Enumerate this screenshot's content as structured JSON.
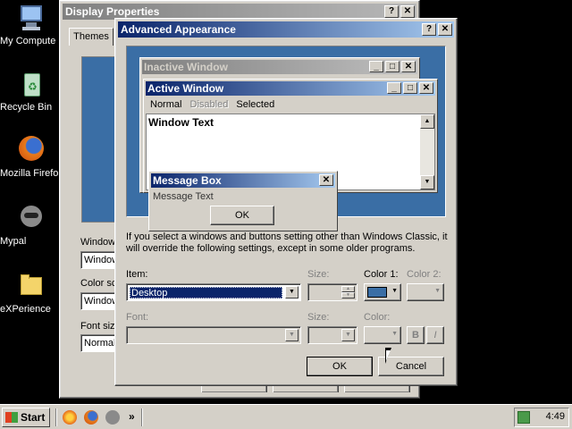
{
  "desktop": {
    "icons": [
      {
        "label": "My Compute",
        "icon": "computer-icon"
      },
      {
        "label": "Recycle Bin",
        "icon": "recycle-bin-icon"
      },
      {
        "label": "Mozilla Firefo",
        "icon": "firefox-icon"
      },
      {
        "label": "Mypal",
        "icon": "mypal-icon"
      },
      {
        "label": "eXPerience",
        "icon": "folder-icon"
      }
    ]
  },
  "display_properties": {
    "title": "Display Properties",
    "tab_themes": "Themes",
    "frag_window": "Window",
    "frag_color_scheme": "Color sc",
    "frag_font_size": "Font size",
    "frag_window_value": "Window",
    "frag_color_value": "Window",
    "frag_font_value": "Normal"
  },
  "advanced_appearance": {
    "title": "Advanced Appearance",
    "preview": {
      "inactive_title": "Inactive Window",
      "active_title": "Active Window",
      "menu_normal": "Normal",
      "menu_disabled": "Disabled",
      "menu_selected": "Selected",
      "window_text": "Window Text",
      "msgbox_title": "Message Box",
      "msgbox_text": "Message Text",
      "msgbox_ok": "OK",
      "frag_in": "In",
      "frag_a": "A",
      "frag_w": "W"
    },
    "info_text": "If you select a windows and buttons setting other than Windows Classic, it will override the following settings, except in some older programs.",
    "labels": {
      "item": "Item:",
      "size": "Size:",
      "color1": "Color 1:",
      "color2": "Color 2:",
      "font": "Font:",
      "font_size": "Size:",
      "font_color": "Color:"
    },
    "item_value": "Desktop",
    "color1_value": "#3a6ea5",
    "bold_label": "B",
    "italic_label": "I",
    "ok_label": "OK",
    "cancel_label": "Cancel"
  },
  "taskbar": {
    "start_label": "Start",
    "quick_more": "»",
    "clock": "4:49"
  },
  "colors": {
    "active_title": "#0a246a",
    "desktop_blue": "#3a6ea5",
    "face": "#d4d0c8"
  }
}
